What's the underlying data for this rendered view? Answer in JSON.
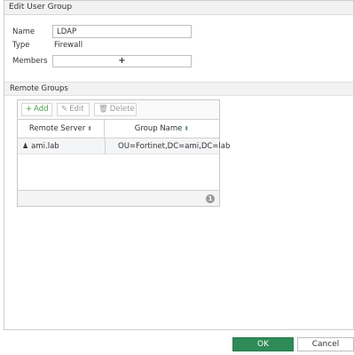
{
  "dialog": {
    "title": "Edit User Group"
  },
  "form": {
    "name_label": "Name",
    "name_value": "LDAP",
    "type_label": "Type",
    "type_value": "Firewall",
    "members_label": "Members",
    "members_add_symbol": "+"
  },
  "remote_groups": {
    "section_title": "Remote Groups",
    "toolbar": {
      "add_label": "Add",
      "edit_label": "Edit",
      "delete_label": "Delete"
    },
    "columns": [
      "Remote Server",
      "Group Name"
    ],
    "rows": [
      {
        "remote_server": "ami.lab",
        "group_name": "OU=Fortinet,DC=ami,DC=lab"
      }
    ],
    "count": "1"
  },
  "footer": {
    "ok_label": "OK",
    "cancel_label": "Cancel"
  },
  "colors": {
    "accent_green": "#2e8b57",
    "add_green": "#4a9e4a"
  },
  "icons": {
    "add": "plus-icon",
    "edit": "pencil-icon",
    "delete": "trash-icon",
    "sort": "sort-icon",
    "server": "user-group-icon"
  }
}
